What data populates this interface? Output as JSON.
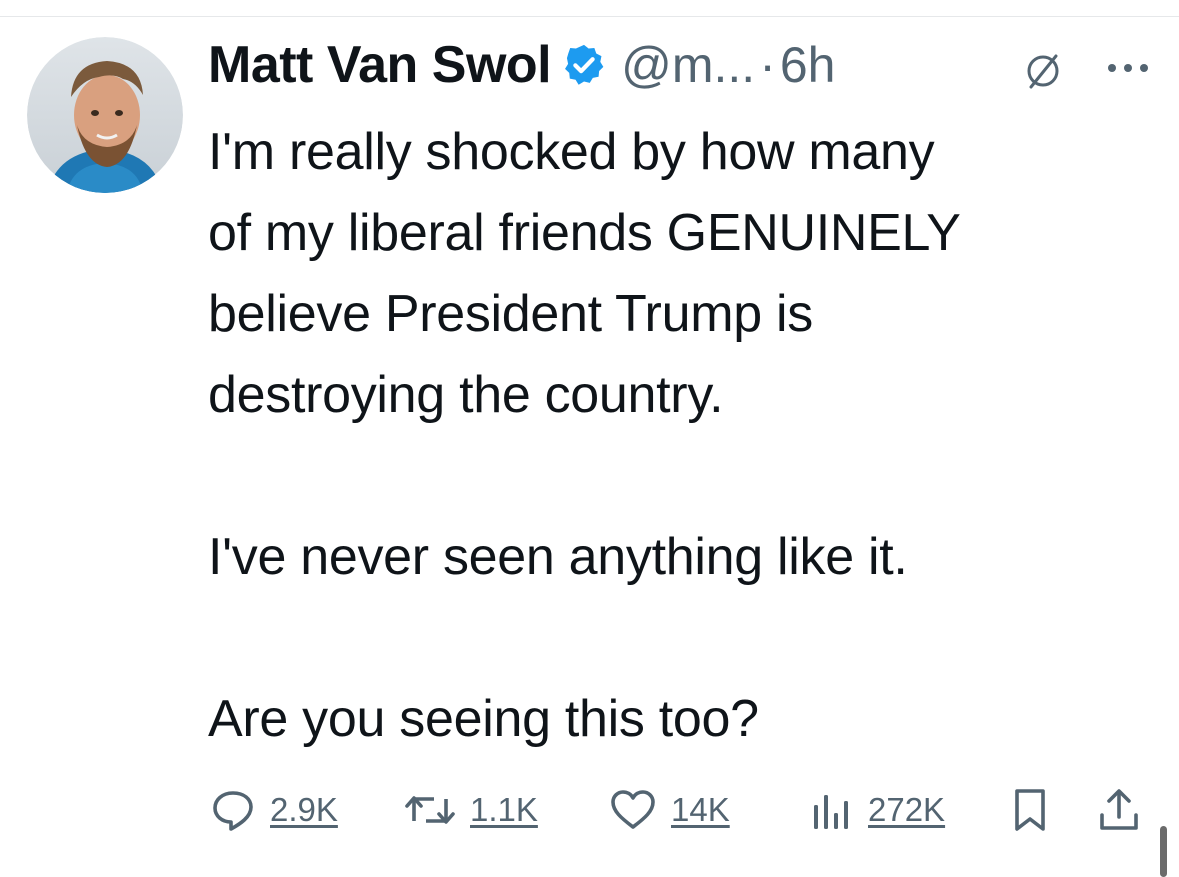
{
  "tweet": {
    "author_name": "Matt Van Swol",
    "handle": "@m...",
    "separator": "·",
    "time": "6h",
    "verified": true,
    "text": "I'm really shocked by how many\nof my liberal friends GENUINELY\nbelieve President Trump is\ndestroying the country.\n\nI've never seen anything like it.\n\nAre you seeing this too?"
  },
  "actions": {
    "replies": "2.9K",
    "reposts": "1.1K",
    "likes": "14K",
    "views": "272K"
  },
  "icons": {
    "verified": "verified-badge-icon",
    "grok": "grok-icon",
    "more": "more-icon",
    "reply": "reply-icon",
    "repost": "repost-icon",
    "like": "heart-icon",
    "views": "views-icon",
    "bookmark": "bookmark-icon",
    "share": "share-icon"
  },
  "colors": {
    "text": "#0f1419",
    "secondary": "#536471",
    "verified": "#1d9bf0"
  }
}
